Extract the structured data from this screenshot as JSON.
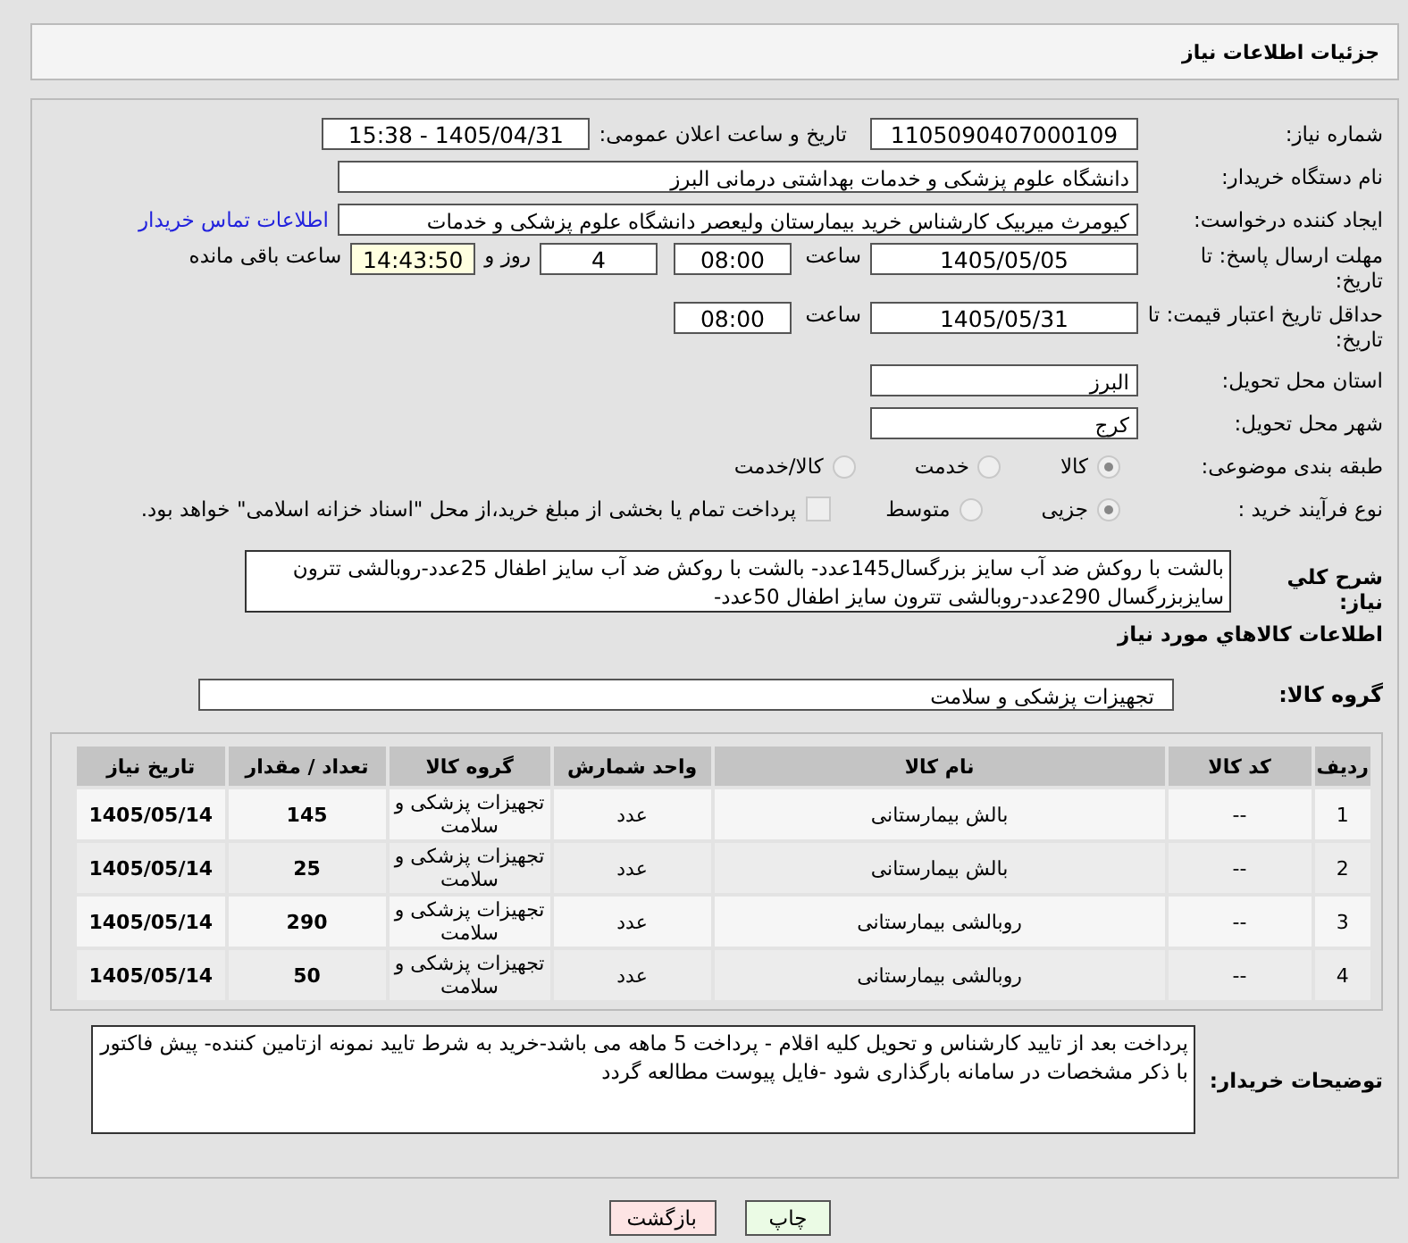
{
  "header": {
    "title": "جزئیات اطلاعات نیاز"
  },
  "need_number": {
    "label": "شماره نیاز:",
    "value": "1105090407000109"
  },
  "announce": {
    "label": "تاریخ و ساعت اعلان عمومی:",
    "value": "1405/04/31 - 15:38"
  },
  "buyer_org": {
    "label": "نام دستگاه خریدار:",
    "value": "دانشگاه علوم پزشکی و خدمات بهداشتی  درمانی البرز"
  },
  "requester": {
    "label": "ایجاد کننده درخواست:",
    "value": "کیومرث میربیک کارشناس خرید بیمارستان ولیعصر دانشگاه علوم پزشکی و خدمات",
    "link": "اطلاعات تماس خریدار"
  },
  "deadline": {
    "label": "مهلت ارسال پاسخ: تا تاریخ:",
    "date": "1405/05/05",
    "time_label": "ساعت",
    "time": "08:00",
    "days": "4",
    "days_label": "روز و",
    "remaining": "14:43:50",
    "remaining_label": "ساعت باقی مانده"
  },
  "validity": {
    "label": "حداقل تاریخ اعتبار قیمت: تا تاریخ:",
    "date": "1405/05/31",
    "time_label": "ساعت",
    "time": "08:00"
  },
  "province": {
    "label": "استان محل تحویل:",
    "value": "البرز"
  },
  "city": {
    "label": "شهر محل تحویل:",
    "value": "کرج"
  },
  "category": {
    "label": "طبقه بندی موضوعی:",
    "options": [
      {
        "label": "کالا",
        "selected": true
      },
      {
        "label": "خدمت",
        "selected": false
      },
      {
        "label": "کالا/خدمت",
        "selected": false
      }
    ]
  },
  "process": {
    "label": "نوع فرآیند خرید :",
    "options": [
      {
        "label": "جزیی",
        "selected": true
      },
      {
        "label": "متوسط",
        "selected": false
      }
    ],
    "payment": {
      "label": "پرداخت تمام یا بخشی از مبلغ خرید،از محل \"اسناد خزانه اسلامی\" خواهد بود.",
      "checked": false
    }
  },
  "description": {
    "label": "شرح کلي نياز:",
    "value": "بالشت با روکش ضد آب سایز بزرگسال145عدد- بالشت با روکش ضد آب سایز اطفال 25عدد-روبالشی تترون سایزبزرگسال 290عدد-روبالشی تترون سایز اطفال 50عدد-"
  },
  "goods_heading": "اطلاعات کالاهاي مورد نياز",
  "goods_group": {
    "label": "گروه کالا:",
    "value": "تجهیزات پزشکی و سلامت"
  },
  "table": {
    "columns": [
      "رديف",
      "کد کالا",
      "نام کالا",
      "واحد شمارش",
      "گروه کالا",
      "تعداد / مقدار",
      "تاریخ نیاز"
    ],
    "rows": [
      [
        "1",
        "--",
        "بالش بیمارستانی",
        "عدد",
        "تجهیزات پزشکی و سلامت",
        "145",
        "1405/05/14"
      ],
      [
        "2",
        "--",
        "بالش بیمارستانی",
        "عدد",
        "تجهیزات پزشکی و سلامت",
        "25",
        "1405/05/14"
      ],
      [
        "3",
        "--",
        "روبالشی بیمارستانی",
        "عدد",
        "تجهیزات پزشکی و سلامت",
        "290",
        "1405/05/14"
      ],
      [
        "4",
        "--",
        "روبالشی بیمارستانی",
        "عدد",
        "تجهیزات پزشکی و سلامت",
        "50",
        "1405/05/14"
      ]
    ]
  },
  "buyer_notes": {
    "label": "توضیحات خریدار:",
    "value": "پرداخت بعد از تایید کارشناس و تحویل کلیه اقلام - پرداخت 5 ماهه می باشد-خرید به شرط تایید نمونه ازتامین کننده- پیش فاکتور با ذکر مشخصات در سامانه بارگذاری شود -فایل پیوست مطالعه گردد"
  },
  "buttons": [
    {
      "label": "چاپ",
      "kind": "print"
    },
    {
      "label": "بازگشت",
      "kind": "back"
    }
  ]
}
